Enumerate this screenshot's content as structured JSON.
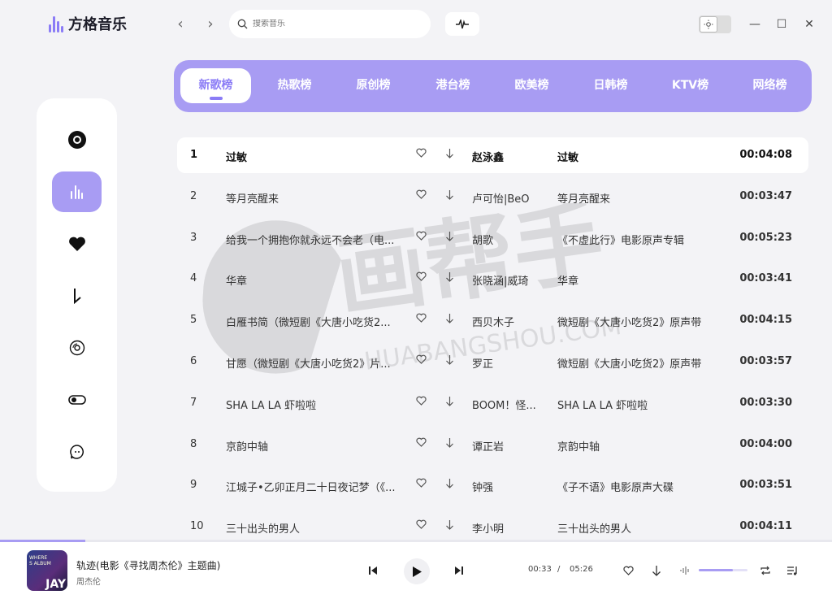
{
  "app": {
    "title": "方格音乐"
  },
  "search": {
    "placeholder": "搜索音乐"
  },
  "tabs": [
    {
      "label": "新歌榜",
      "active": true
    },
    {
      "label": "热歌榜"
    },
    {
      "label": "原创榜"
    },
    {
      "label": "港台榜"
    },
    {
      "label": "欧美榜"
    },
    {
      "label": "日韩榜"
    },
    {
      "label": "KTV榜"
    },
    {
      "label": "网络榜"
    }
  ],
  "sidebar": {
    "items": [
      {
        "icon": "disc-icon"
      },
      {
        "icon": "chart-bars-icon",
        "active": true
      },
      {
        "icon": "heart-icon"
      },
      {
        "icon": "download-arrow-icon"
      },
      {
        "icon": "cd-icon"
      },
      {
        "icon": "toggle-icon"
      },
      {
        "icon": "chat-bubble-icon"
      }
    ]
  },
  "songs": [
    {
      "idx": "1",
      "title": "过敏",
      "artist": "赵泳鑫",
      "album": "过敏",
      "duration": "00:04:08"
    },
    {
      "idx": "2",
      "title": "等月亮醒来",
      "artist": "卢可怡|BeO",
      "album": "等月亮醒来",
      "duration": "00:03:47"
    },
    {
      "idx": "3",
      "title": "给我一个拥抱你就永远不会老（电...",
      "artist": "胡歌",
      "album": "《不虚此行》电影原声专辑",
      "duration": "00:05:23"
    },
    {
      "idx": "4",
      "title": "华章",
      "artist": "张晓涵|威琦",
      "album": "华章",
      "duration": "00:03:41"
    },
    {
      "idx": "5",
      "title": "白雁书简（微短剧《大唐小吃货2...",
      "artist": "西贝木子",
      "album": "微短剧《大唐小吃货2》原声带",
      "duration": "00:04:15"
    },
    {
      "idx": "6",
      "title": "甘愿（微短剧《大唐小吃货2》片...",
      "artist": "罗正",
      "album": "微短剧《大唐小吃货2》原声带",
      "duration": "00:03:57"
    },
    {
      "idx": "7",
      "title": "SHA LA LA 虾啦啦",
      "artist": "BOOM！怪...",
      "album": "SHA LA LA 虾啦啦",
      "duration": "00:03:30"
    },
    {
      "idx": "8",
      "title": "京韵中轴",
      "artist": "谭正岩",
      "album": "京韵中轴",
      "duration": "00:04:00"
    },
    {
      "idx": "9",
      "title": "江城子•乙卯正月二十日夜记梦（《...",
      "artist": "钟强",
      "album": "《子不语》电影原声大碟",
      "duration": "00:03:51"
    },
    {
      "idx": "10",
      "title": "三十出头的男人",
      "artist": "李小明",
      "album": "三十出头的男人",
      "duration": "00:04:11"
    }
  ],
  "player": {
    "title": "轨迹(电影《寻找周杰伦》主题曲)",
    "artist": "周杰伦",
    "current": "00:33",
    "separator": "/",
    "total": "05:26",
    "progress": 0.103,
    "volume": 0.7,
    "cover_text": "JAY"
  },
  "watermark": {
    "main": "画帮手",
    "sub": "HUABANGSHOU.COM"
  },
  "colors": {
    "accent": "#a89cf3",
    "accent_dark": "#8b7cf6",
    "bg": "#f3f3f6"
  }
}
